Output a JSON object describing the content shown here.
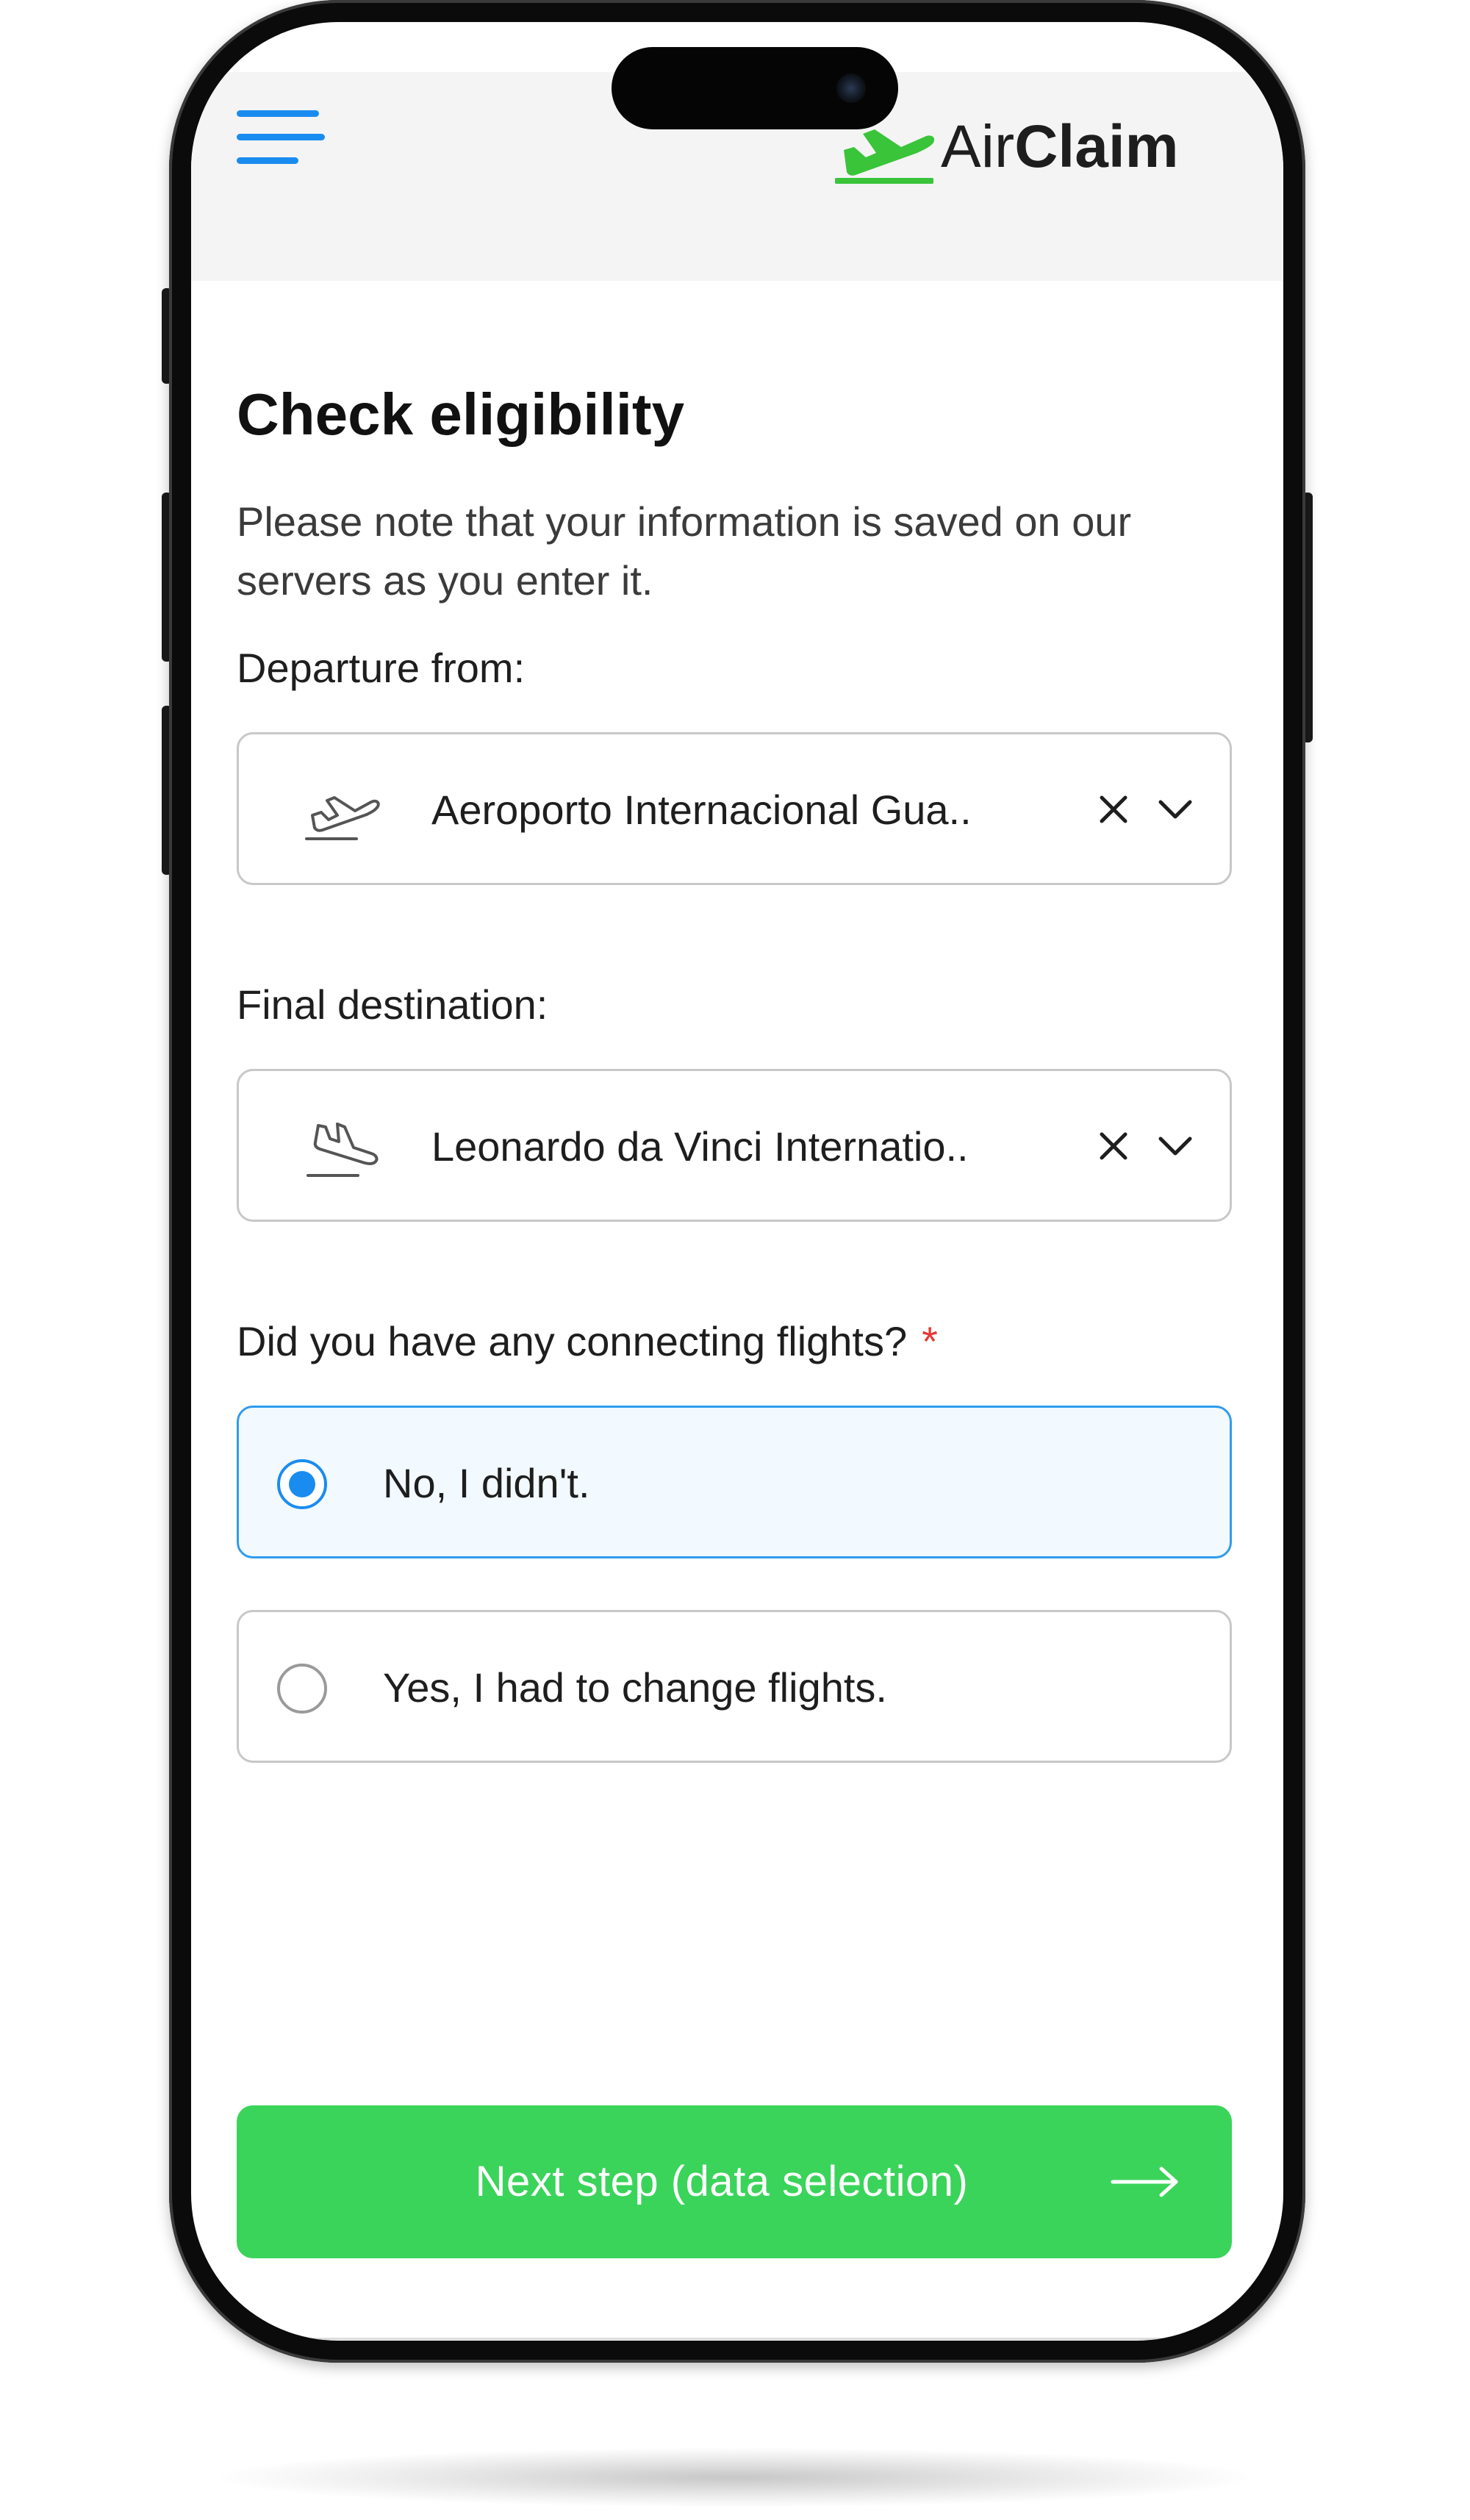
{
  "header": {
    "menu_icon": "hamburger-menu-icon",
    "logo": {
      "icon": "airplane-takeoff-logo-icon",
      "text_light": "Air",
      "text_bold": "Claim",
      "accent_color": "#3ac43a"
    }
  },
  "form": {
    "title": "Check eligibility",
    "note": "Please note that your information is saved on our servers as you enter it.",
    "departure": {
      "label": "Departure from:",
      "icon": "plane-takeoff-icon",
      "value": "Aeroporto Internacional Gua.."
    },
    "destination": {
      "label": "Final destination:",
      "icon": "plane-landing-icon",
      "value": "Leonardo da Vinci Internatio.."
    },
    "connecting": {
      "question": "Did you have any connecting flights?",
      "required_mark": "*",
      "options": [
        {
          "label": "No, I didn't.",
          "selected": true
        },
        {
          "label": "Yes, I had to change flights.",
          "selected": false
        }
      ]
    },
    "next_button": {
      "label": "Next step (data selection)",
      "icon": "arrow-right-icon",
      "color": "#3ad45a"
    }
  },
  "colors": {
    "primary_blue": "#1a8cf0",
    "selected_bg": "#f2f9ff",
    "required_red": "#e53935"
  }
}
